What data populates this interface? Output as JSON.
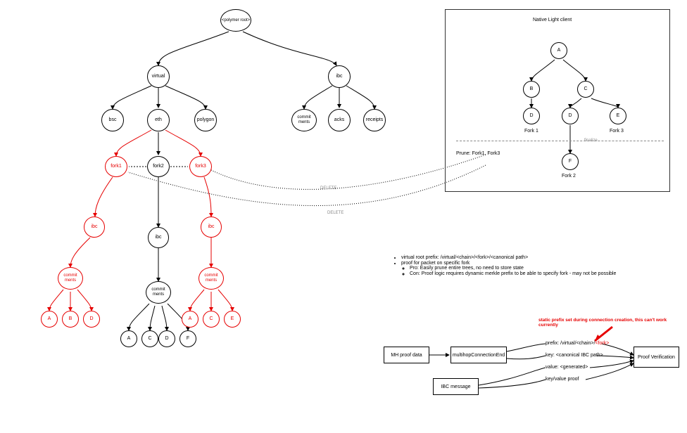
{
  "tree": {
    "root": "<polymer root>",
    "virtual": "virtual",
    "bsc": "bsc",
    "eth": "eth",
    "polygon": "polygon",
    "ibc_top": "ibc",
    "commitments": "commit ments",
    "acks": "acks",
    "receipts": "receipts",
    "fork1": "fork1",
    "fork2": "fork2",
    "fork3": "fork3",
    "ibc": "ibc",
    "A": "A",
    "B": "B",
    "C": "C",
    "D": "D",
    "E": "E",
    "F": "F"
  },
  "panel": {
    "title": "Native Light client",
    "A": "A",
    "B": "B",
    "C": "C",
    "D": "D",
    "E": "E",
    "F": "F",
    "fork1": "Fork 1",
    "fork3": "Fork 3",
    "fork2": "Fork 2",
    "prune": "Prune: Fork1, Fork3",
    "finalize": "finalize"
  },
  "edge_labels": {
    "delete": "DELETE"
  },
  "notes": {
    "l1": "virtual root prefix: /virtual/<chain>/<fork>/<canonical path>",
    "l2": "proof for packet on specific fork",
    "l2a": "Pro: Easily prune entire trees, no need to store state",
    "l2b": "Con: Proof logic requires dynamic merkle prefix to be able to specify fork - may not be possible"
  },
  "flow": {
    "mh_proof": "MH proof data",
    "multihop": "multihopConnectionEnd",
    "ibc_msg": "IBC message",
    "prefix": "prefix: /virtual/<chain>/",
    "prefix_fork": "<fork>",
    "key": "key: <canonical IBC path>",
    "value": "value: <generated>",
    "kvproof": "key/value proof",
    "verify": "Proof Verification",
    "warn": "static prefix set during connection creation, this can't work currently"
  }
}
